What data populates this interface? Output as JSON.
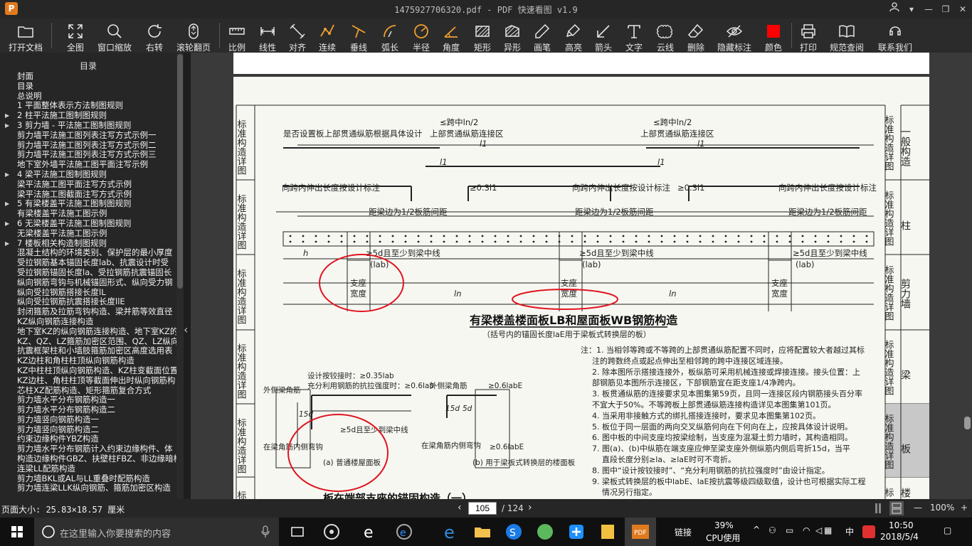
{
  "window": {
    "logo": "P",
    "title": "1475927706320.pdf - PDF 快速看图 v1.9"
  },
  "toolbar": [
    {
      "name": "open-file-button",
      "label": "打开文档",
      "icon": "folder-icon"
    },
    {
      "name": "fit-page-button",
      "label": "全图",
      "icon": "expand-icon"
    },
    {
      "name": "window-zoom-button",
      "label": "窗口缩放",
      "icon": "magnifier-icon"
    },
    {
      "name": "rotate-right-button",
      "label": "右转",
      "icon": "rotate-icon"
    },
    {
      "name": "scroll-page-button",
      "label": "滚轮翻页",
      "icon": "mouse-icon"
    },
    {
      "name": "scale-button",
      "label": "比例",
      "icon": "ruler-icon"
    },
    {
      "name": "linear-button",
      "label": "线性",
      "icon": "linear-icon"
    },
    {
      "name": "aligned-button",
      "label": "对齐",
      "icon": "aligned-icon"
    },
    {
      "name": "continuous-button",
      "label": "连续",
      "icon": "polyline-icon"
    },
    {
      "name": "perpendicular-button",
      "label": "垂线",
      "icon": "perpendicular-icon"
    },
    {
      "name": "arc-length-button",
      "label": "弧长",
      "icon": "arc-icon"
    },
    {
      "name": "radius-button",
      "label": "半径",
      "icon": "radius-icon"
    },
    {
      "name": "angle-button",
      "label": "角度",
      "icon": "angle-icon"
    },
    {
      "name": "rectangle-button",
      "label": "矩形",
      "icon": "rectangle-icon"
    },
    {
      "name": "irregular-button",
      "label": "异形",
      "icon": "irregular-icon"
    },
    {
      "name": "pencil-button",
      "label": "画笔",
      "icon": "pencil-icon"
    },
    {
      "name": "highlight-button",
      "label": "高亮",
      "icon": "highlighter-icon"
    },
    {
      "name": "arrow-button",
      "label": "箭头",
      "icon": "arrow-icon"
    },
    {
      "name": "text-button",
      "label": "文字",
      "icon": "text-icon"
    },
    {
      "name": "cloud-button",
      "label": "云线",
      "icon": "cloud-icon"
    },
    {
      "name": "delete-button",
      "label": "删除",
      "icon": "eraser-icon"
    },
    {
      "name": "hide-marks-button",
      "label": "隐藏标注",
      "icon": "eye-off-icon"
    },
    {
      "name": "color-button",
      "label": "颜色",
      "icon": "color-swatch-icon"
    },
    {
      "name": "print-button",
      "label": "打印",
      "icon": "printer-icon"
    },
    {
      "name": "spec-lookup-button",
      "label": "规范查阅",
      "icon": "book-icon"
    },
    {
      "name": "contact-button",
      "label": "联系我们",
      "icon": "support-icon"
    }
  ],
  "sidebar": {
    "title": "目录",
    "items": [
      {
        "label": "封面",
        "arrow": ""
      },
      {
        "label": "目录",
        "arrow": ""
      },
      {
        "label": "总说明",
        "arrow": ""
      },
      {
        "label": "1 平面整体表示方法制图规则",
        "arrow": ""
      },
      {
        "label": "2 柱平法施工图制图规则",
        "arrow": "▶"
      },
      {
        "label": "3 剪力墙 - 平法施工图制图规则",
        "arrow": "▶"
      },
      {
        "label": "剪力墙平法施工图列表注写方式示例一",
        "arrow": ""
      },
      {
        "label": "剪力墙平法施工图列表注写方式示例二",
        "arrow": ""
      },
      {
        "label": "剪力墙平法施工图列表注写方式示例三",
        "arrow": ""
      },
      {
        "label": "地下室外墙平法施工图平面注写示例",
        "arrow": ""
      },
      {
        "label": "4 梁平法施工图制图规则",
        "arrow": "▶"
      },
      {
        "label": "梁平法施工图平面注写方式示例",
        "arrow": ""
      },
      {
        "label": "梁平法施工图截面注写方式示例",
        "arrow": ""
      },
      {
        "label": "5 有梁楼盖平法施工图制图规则",
        "arrow": "▶"
      },
      {
        "label": "有梁楼盖平法施工图示例",
        "arrow": ""
      },
      {
        "label": "6 无梁楼盖平法施工图制图规则",
        "arrow": "▶"
      },
      {
        "label": "无梁楼盖平法施工图示例",
        "arrow": ""
      },
      {
        "label": "7 楼板相关构造制图规则",
        "arrow": "▶"
      },
      {
        "label": "混凝土结构的环境类别、保护层的最小厚度",
        "arrow": ""
      },
      {
        "label": "受拉钢筋基本锚固长度lab、抗震设计时受",
        "arrow": ""
      },
      {
        "label": "受拉钢筋锚固长度la、受拉钢筋抗震锚固长",
        "arrow": ""
      },
      {
        "label": "纵向钢筋弯钩与机械锚固形式、纵向受力钢",
        "arrow": ""
      },
      {
        "label": "纵向受拉钢筋搭接长度lL",
        "arrow": ""
      },
      {
        "label": "纵向受拉钢筋抗震搭接长度llE",
        "arrow": ""
      },
      {
        "label": "封闭箍筋及拉筋弯钩构造、梁并筋等效直径",
        "arrow": ""
      },
      {
        "label": "KZ纵向钢筋连接构造",
        "arrow": ""
      },
      {
        "label": "地下室KZ的纵向钢筋连接构造、地下室KZ的",
        "arrow": ""
      },
      {
        "label": "KZ、QZ、LZ箍筋加密区范围、QZ、LZ纵向钢",
        "arrow": ""
      },
      {
        "label": "抗震框架柱和小墙肢箍筋加密区高度选用表",
        "arrow": ""
      },
      {
        "label": "KZ边柱和角柱柱顶纵向钢筋构造",
        "arrow": ""
      },
      {
        "label": "KZ中柱柱顶纵向钢筋构造、KZ柱变截面位置",
        "arrow": ""
      },
      {
        "label": "KZ边柱、角柱柱顶等截面伸出时纵向钢筋构",
        "arrow": ""
      },
      {
        "label": "芯柱XZ配筋构造、矩形箍筋复合方式",
        "arrow": ""
      },
      {
        "label": "剪力墙水平分布钢筋构造一",
        "arrow": ""
      },
      {
        "label": "剪力墙水平分布钢筋构造二",
        "arrow": ""
      },
      {
        "label": "剪力墙竖向钢筋构造一",
        "arrow": ""
      },
      {
        "label": "剪力墙竖向钢筋构造二",
        "arrow": ""
      },
      {
        "label": "约束边缘构件YBZ构造",
        "arrow": ""
      },
      {
        "label": "剪力墙水平分布钢筋计入约束边缘构件、体",
        "arrow": ""
      },
      {
        "label": "构造边缘构件GBZ、扶壁柱FBZ、非边缘暗柱",
        "arrow": ""
      },
      {
        "label": "连梁LL配筋构造",
        "arrow": ""
      },
      {
        "label": "剪力墙BKL或AL与LL重叠时配筋构造",
        "arrow": ""
      },
      {
        "label": "剪力墙连梁LLK纵向钢筋、箍筋加密区构造",
        "arrow": ""
      }
    ]
  },
  "drawing": {
    "side_tabs_right": [
      {
        "a": "标准构造详图",
        "b": "一般构造"
      },
      {
        "a": "标准构造详图",
        "b": "柱"
      },
      {
        "a": "标准构造详图",
        "b": "剪力墙"
      },
      {
        "a": "标准构造详图",
        "b": "梁"
      },
      {
        "a": "标准构造详图",
        "b": "板"
      },
      {
        "a": "标",
        "b": "楼"
      }
    ],
    "side_tabs_left": [
      "标准构造详图",
      "标准构造详图",
      "标准构造详图",
      "标准构造详图",
      "标准构造详图",
      "标"
    ],
    "top_labels": {
      "design_note": "是否设置板上部贯通纵筋根据具体设计",
      "span1": "≤跨中ln/2",
      "span1_zone": "上部贯通纵筋连接区",
      "span2": "≤跨中ln/2",
      "span2_zone": "上部贯通纵筋连接区",
      "l1a": "l1",
      "l1b": "l1",
      "l1c": "l1",
      "l1d": "l1",
      "ext1": "向跨内伸出长度按设计标注",
      "ext1_val": "≥0.3l1",
      "ext2": "向跨内伸出长度按设计标注",
      "ext2_val": "≥0.3l1",
      "ext3": "向跨内伸出长度按设计标注",
      "dist1": "距梁边为1/2板筋间距",
      "dist2": "距梁边为1/2板筋间距",
      "dist3": "距梁边为1/2板筋间距",
      "h": "h",
      "anchor1": "≥5d且至少到梁中线",
      "anchor1_sub": "(lab)",
      "anchor2": "≥5d且至少到梁中线",
      "anchor2_sub": "(lab)",
      "anchor3": "≥5d且至少到梁中线",
      "anchor3_sub": "(lab)",
      "support1": "支座",
      "support1b": "宽度",
      "support2": "支座",
      "support2b": "宽度",
      "support3": "支座",
      "support3b": "宽度",
      "ln1": "ln",
      "ln2": "ln"
    },
    "main_title": "有梁楼盖楼面板LB和屋面板WB钢筋构造",
    "main_subtitle": "（括号内的锚固长度laE用于梁板式转换层的板）",
    "notes": [
      "注：1. 当相邻等跨或不等跨的上部贯通纵筋配置不同时，应将配置较大者越过其标",
      "注的跨数终点或起点伸出至相邻跨的跨中连接区域连接。",
      "2. 除本图所示搭接连接外，板纵筋可采用机械连接或焊接连接。接头位置：上",
      "部钢筋见本图所示连接区，下部钢筋宜在距支座1/4净跨内。",
      "3. 板贯通纵筋的连接要求见本图集第59页，且同一连接区段内钢筋接头百分率",
      "不宜大于50%。不等跨板上部贯通纵筋连接构造详见本图集第101页。",
      "4. 当采用非接触方式的绑扎搭接连接时，要求见本图集第102页。",
      "5. 板位于同一层面的两向交叉纵筋何向在下何向在上，应按具体设计说明。",
      "6. 图中板的中间支座均按梁绘制，当支座为混凝土剪力墙时，其构造相同。",
      "7. 图(a)、(b)中纵筋在端支座应伸至梁支座外侧纵筋内侧后弯折15d，当平",
      "直段长度分别≥la、≥laE时可不弯折。",
      "8. 图中“设计按铰接时”、“充分利用钢筋的抗拉强度时”由设计指定。",
      "9. 梁板式转换层的板中labE、laE按抗震等级四级取值，设计也可根据实际工程",
      "情况另行指定。"
    ],
    "detail_a": {
      "hinge": "设计按铰接时：≥0.35lab",
      "full": "充分利用钢筋的抗拉强度时：≥0.6lab",
      "outer": "外侧梁角筋",
      "d15": "15d",
      "anchor": "≥5d且至少到梁中线",
      "inner": "在梁角筋内侧弯钩",
      "caption": "(a) 普通楼屋面板"
    },
    "detail_b": {
      "outer": "外侧梁角筋",
      "lab": "≥0.6labE",
      "d15": "15d",
      "d5": "5d",
      "inner": "在梁角筋内侧弯钩",
      "lab2": "≥0.6labE",
      "caption": "(b) 用于梁板式转换层的楼面板"
    },
    "bottom_title": "板在端部支座的锚固构造（一）"
  },
  "statusbar": {
    "page_size": "页面大小: 25.83×18.57 厘米",
    "prev": "‹",
    "current_page": "105",
    "total": "/ 124",
    "next": "›",
    "zoom_minus": "—",
    "zoom_value": "100%",
    "zoom_plus": "+"
  },
  "taskbar": {
    "search_placeholder": "在这里输入你要搜索的内容",
    "link_label": "链接",
    "cpu_value": "39%",
    "cpu_label": "CPU使用",
    "ime": "中",
    "time": "10:50",
    "date": "2018/5/4"
  },
  "colors": {
    "annotation_red": "#e0141e",
    "toolbar_bg": "#2b2b2b",
    "accent_orange": "#e07a1e",
    "color_swatch": "#ff0000"
  }
}
